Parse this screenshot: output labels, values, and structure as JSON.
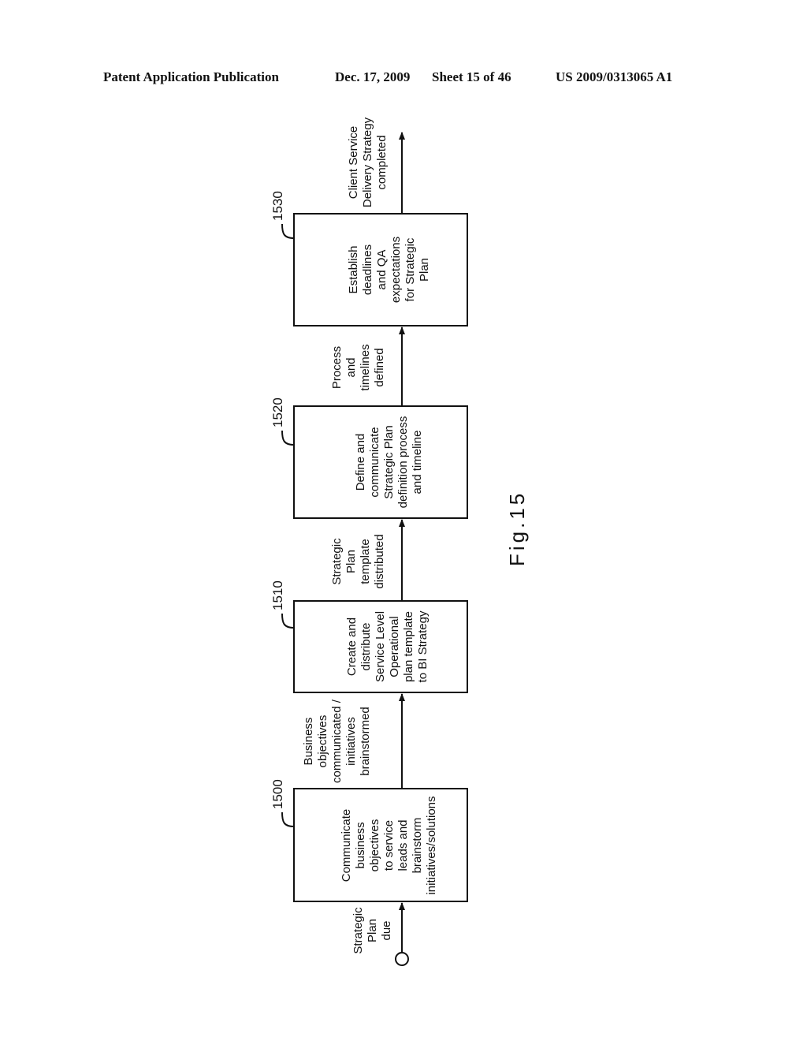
{
  "header": {
    "publication": "Patent Application Publication",
    "date": "Dec. 17, 2009",
    "sheet": "Sheet 15 of 46",
    "number": "US 2009/0313065 A1"
  },
  "figure": {
    "label": "Fig.15",
    "start_label": [
      "Strategic",
      "Plan",
      "due"
    ],
    "steps": [
      {
        "ref": "1500",
        "text": [
          "Communicate",
          "business",
          "objectives",
          "to service",
          "leads and",
          "brainstorm",
          "initiatives/solutions"
        ],
        "output_label": [
          "Business",
          "objectives",
          "communicated /",
          "initiatives",
          "brainstormed"
        ]
      },
      {
        "ref": "1510",
        "text": [
          "Create and",
          "distribute",
          "Service Level",
          "Operational",
          "plan template",
          "to BI Strategy"
        ],
        "output_label": [
          "Strategic",
          "Plan",
          "template",
          "distributed"
        ]
      },
      {
        "ref": "1520",
        "text": [
          "Define and",
          "communicate",
          "Strategic Plan",
          "definition process",
          "and timeline"
        ],
        "output_label": [
          "Process",
          "and",
          "timelines",
          "defined"
        ]
      },
      {
        "ref": "1530",
        "text": [
          "Establish",
          "deadlines",
          "and QA",
          "expectations",
          "for Strategic",
          "Plan"
        ],
        "output_label": [
          "Client Service",
          "Delivery Strategy",
          "completed"
        ]
      }
    ]
  }
}
